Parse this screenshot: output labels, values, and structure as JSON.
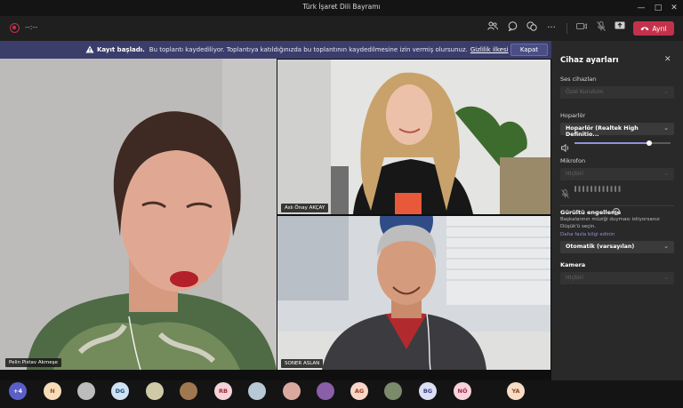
{
  "window": {
    "title": "Türk İşaret Dili Bayramı"
  },
  "toolbar": {
    "timer": "--:--",
    "leave_label": "Ayrıl",
    "leave_color": "#c4314b"
  },
  "banner": {
    "strong_text": "Kayıt başladı.",
    "message": "Bu toplantı kaydediliyor. Toplantıya katıldığınızda bu toplantının kaydedilmesine izin vermiş olursunuz.",
    "link": "Gizlilik ilkesi",
    "close_label": "Kapat",
    "color": "#3b3d6b"
  },
  "tiles": [
    {
      "name": "Pelin Pistav Akmeşe"
    },
    {
      "name": "Aslı Önay AKÇAY"
    },
    {
      "name": "SONER ASLAN"
    }
  ],
  "panel": {
    "title": "Cihaz ayarları",
    "audio_label": "Ses cihazları",
    "audio_value": "Özel Kurulum",
    "speaker_label": "Hoparlör",
    "speaker_value": "Hoparlör (Realtek High Definitio...",
    "speaker_volume": 0.78,
    "mic_label": "Mikrofon",
    "mic_value": "Hiçbiri",
    "noise_label": "Gürültü engelleme",
    "noise_desc": "Başkalarının müziği duyması istiyorsanız Düşük'ü seçin.",
    "noise_link": "Daha fazla bilgi edinin",
    "noise_value": "Otomatik (varsayılan)",
    "camera_label": "Kamera",
    "camera_value": "Hiçbiri",
    "accent": "#8f92dd"
  },
  "participants": [
    {
      "label": "+4",
      "bg": "#5b5fc7",
      "fg": "#ffffff"
    },
    {
      "label": "N",
      "bg": "#f6dcb8",
      "fg": "#8a5a1e"
    },
    {
      "label": "",
      "bg": "#bcbcbc",
      "fg": "#333333"
    },
    {
      "label": "DG",
      "bg": "#cfe3f5",
      "fg": "#1c4f7a"
    },
    {
      "label": "",
      "bg": "#d0c9a8",
      "fg": "#333333"
    },
    {
      "label": "",
      "bg": "#a07850",
      "fg": "#333333"
    },
    {
      "label": "RB",
      "bg": "#f4d3d8",
      "fg": "#9b2737"
    },
    {
      "label": "",
      "bg": "#b9c8d6",
      "fg": "#333333"
    },
    {
      "label": "",
      "bg": "#d9a9a0",
      "fg": "#333333"
    },
    {
      "label": "",
      "bg": "#8a5fa8",
      "fg": "#333333"
    },
    {
      "label": "AG",
      "bg": "#f8d7c8",
      "fg": "#9a3b1a"
    },
    {
      "label": "",
      "bg": "#7b8a6a",
      "fg": "#333333"
    },
    {
      "label": "BG",
      "bg": "#dcdff4",
      "fg": "#3b3f8a"
    },
    {
      "label": "NÖ",
      "bg": "#f6d3dc",
      "fg": "#a12646"
    },
    {
      "label": "YA",
      "bg": "#f8dcc6",
      "fg": "#8f4a17"
    }
  ]
}
